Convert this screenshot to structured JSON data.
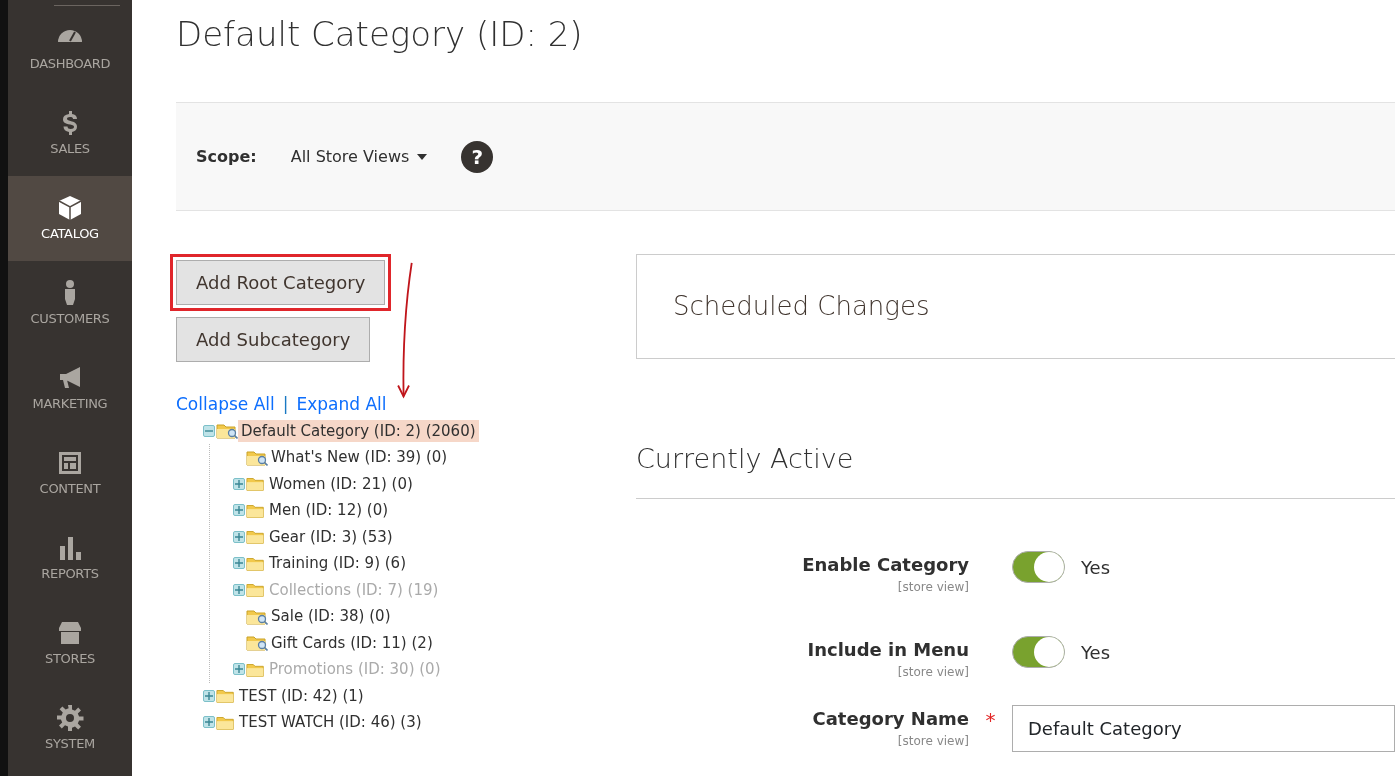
{
  "sidebar": {
    "items": [
      {
        "label": "DASHBOARD",
        "selected": false
      },
      {
        "label": "SALES",
        "selected": false
      },
      {
        "label": "CATALOG",
        "selected": true
      },
      {
        "label": "CUSTOMERS",
        "selected": false
      },
      {
        "label": "MARKETING",
        "selected": false
      },
      {
        "label": "CONTENT",
        "selected": false
      },
      {
        "label": "REPORTS",
        "selected": false
      },
      {
        "label": "STORES",
        "selected": false
      },
      {
        "label": "SYSTEM",
        "selected": false
      }
    ]
  },
  "page_title": "Default Category (ID: 2)",
  "scope": {
    "label": "Scope:",
    "value": "All Store Views",
    "help": "?"
  },
  "buttons": [
    {
      "label": "Add Root Category",
      "highlighted": true
    },
    {
      "label": "Add Subcategory",
      "highlighted": false
    }
  ],
  "annotation": {
    "kind": "arrow"
  },
  "tree_links": [
    {
      "label": "Collapse All"
    },
    {
      "label": "|"
    },
    {
      "label": "Expand All"
    }
  ],
  "tree": [
    {
      "label": "Default Category (ID: 2) (2060)",
      "selected": true,
      "expanded": true,
      "anchor": true,
      "greyed": false,
      "children": [
        {
          "label": "What's New (ID: 39) (0)",
          "selected": false,
          "expanded": false,
          "anchor": true,
          "greyed": false
        },
        {
          "label": "Women (ID: 21) (0)",
          "selected": false,
          "expanded": false,
          "anchor": false,
          "greyed": false,
          "expandable": true
        },
        {
          "label": "Men (ID: 12) (0)",
          "selected": false,
          "expanded": false,
          "anchor": false,
          "greyed": false,
          "expandable": true
        },
        {
          "label": "Gear (ID: 3) (53)",
          "selected": false,
          "expanded": false,
          "anchor": false,
          "greyed": false,
          "expandable": true
        },
        {
          "label": "Training (ID: 9) (6)",
          "selected": false,
          "expanded": false,
          "anchor": false,
          "greyed": false,
          "expandable": true
        },
        {
          "label": "Collections (ID: 7) (19)",
          "selected": false,
          "expanded": false,
          "anchor": false,
          "greyed": true,
          "expandable": true
        },
        {
          "label": "Sale (ID: 38) (0)",
          "selected": false,
          "expanded": false,
          "anchor": true,
          "greyed": false
        },
        {
          "label": "Gift Cards (ID: 11) (2)",
          "selected": false,
          "expanded": false,
          "anchor": true,
          "greyed": false
        },
        {
          "label": "Promotions (ID: 30) (0)",
          "selected": false,
          "expanded": false,
          "anchor": false,
          "greyed": true,
          "expandable": true
        }
      ]
    },
    {
      "label": "TEST (ID: 42) (1)",
      "selected": false,
      "expanded": false,
      "anchor": false,
      "greyed": false,
      "expandable": true
    },
    {
      "label": "TEST WATCH (ID: 46) (3)",
      "selected": false,
      "expanded": false,
      "anchor": false,
      "greyed": false,
      "expandable": true
    }
  ],
  "scheduled_changes": {
    "title": "Scheduled Changes"
  },
  "section_title": "Currently Active",
  "fields": [
    {
      "kind": "toggle",
      "label": "Enable Category",
      "scope": "[store view]",
      "on": true,
      "value": "Yes"
    },
    {
      "kind": "toggle",
      "label": "Include in Menu",
      "scope": "[store view]",
      "on": true,
      "value": "Yes"
    },
    {
      "kind": "text",
      "label": "Category Name",
      "scope": "[store view]",
      "required": true,
      "required_mark": "*",
      "value": "Default Category"
    }
  ]
}
